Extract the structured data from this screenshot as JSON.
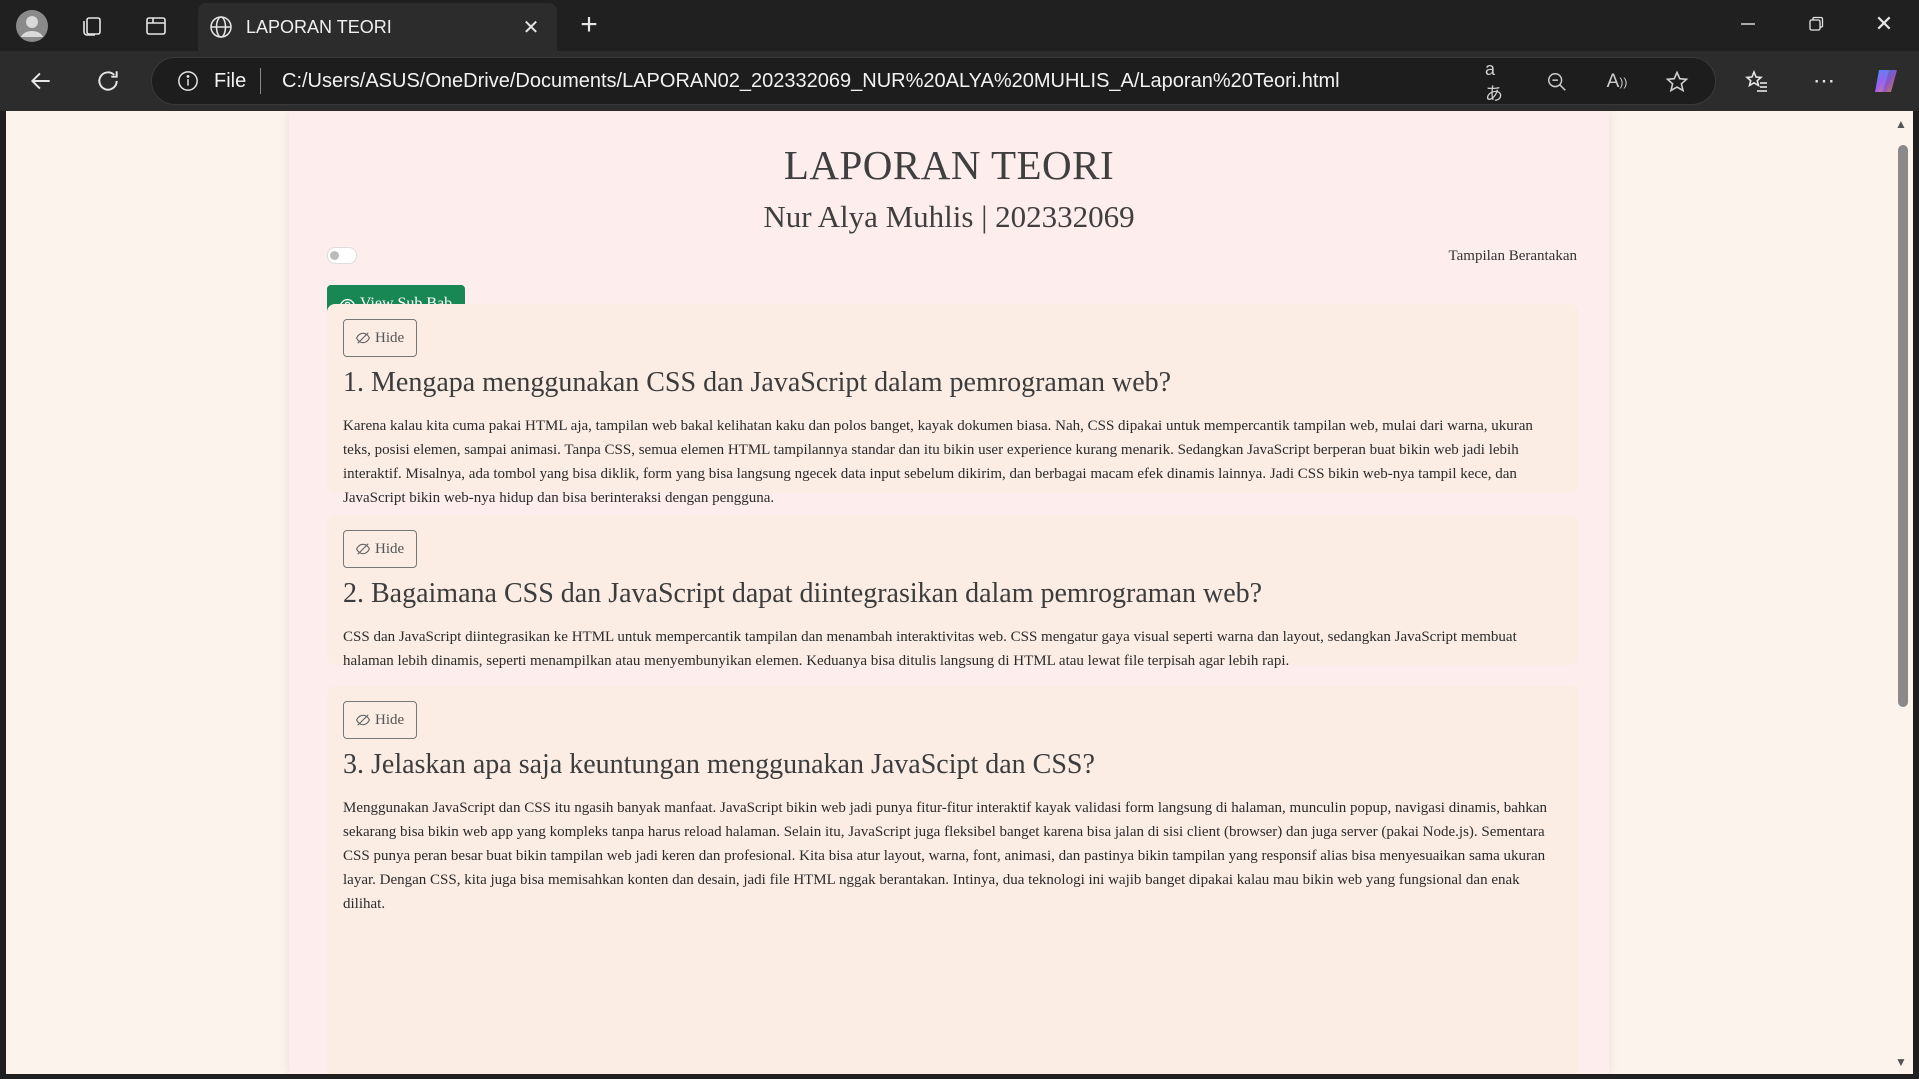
{
  "browser": {
    "tab_title": "LAPORAN TEORI",
    "url_scheme": "File",
    "url": "C:/Users/ASUS/OneDrive/Documents/LAPORAN02_202332069_NUR%20ALYA%20MUHLIS_A/Laporan%20Teori.html"
  },
  "page": {
    "title": "LAPORAN TEORI",
    "subtitle": "Nur Alya Muhlis | 202332069",
    "toggle_label": "Tampilan Berantakan",
    "view_button": "View Sub Bab",
    "hide_label": "Hide",
    "sections": [
      {
        "heading": "1. Mengapa menggunakan CSS dan JavaScript dalam pemrograman web?",
        "body": "Karena kalau kita cuma pakai HTML aja, tampilan web bakal kelihatan kaku dan polos banget, kayak dokumen biasa. Nah, CSS dipakai untuk mempercantik tampilan web, mulai dari warna, ukuran teks, posisi elemen, sampai animasi. Tanpa CSS, semua elemen HTML tampilannya standar dan itu bikin user experience kurang menarik. Sedangkan JavaScript berperan buat bikin web jadi lebih interaktif. Misalnya, ada tombol yang bisa diklik, form yang bisa langsung ngecek data input sebelum dikirim, dan berbagai macam efek dinamis lainnya. Jadi CSS bikin web-nya tampil kece, dan JavaScript bikin web-nya hidup dan bisa berinteraksi dengan pengguna."
      },
      {
        "heading": "2. Bagaimana CSS dan JavaScript dapat diintegrasikan dalam pemrograman web?",
        "body": "CSS dan JavaScript diintegrasikan ke HTML untuk mempercantik tampilan dan menambah interaktivitas web. CSS mengatur gaya visual seperti warna dan layout, sedangkan JavaScript membuat halaman lebih dinamis, seperti menampilkan atau menyembunyikan elemen. Keduanya bisa ditulis langsung di HTML atau lewat file terpisah agar lebih rapi."
      },
      {
        "heading": "3. Jelaskan apa saja keuntungan menggunakan JavaScipt dan CSS?",
        "body": "Menggunakan JavaScript dan CSS itu ngasih banyak manfaat. JavaScript bikin web jadi punya fitur-fitur interaktif kayak validasi form langsung di halaman, munculin popup, navigasi dinamis, bahkan sekarang bisa bikin web app yang kompleks tanpa harus reload halaman. Selain itu, JavaScript juga fleksibel banget karena bisa jalan di sisi client (browser) dan juga server (pakai Node.js). Sementara CSS punya peran besar buat bikin tampilan web jadi keren dan profesional. Kita bisa atur layout, warna, font, animasi, dan pastinya bikin tampilan yang responsif alias bisa menyesuaikan sama ukuran layar. Dengan CSS, kita juga bisa memisahkan konten dan desain, jadi file HTML nggak berantakan. Intinya, dua teknologi ini wajib banget dipakai kalau mau bikin web yang fungsional dan enak dilihat."
      }
    ]
  },
  "colors": {
    "primary_button": "#198754",
    "page_background": "#fdedec",
    "card_background": "#fbede4"
  }
}
